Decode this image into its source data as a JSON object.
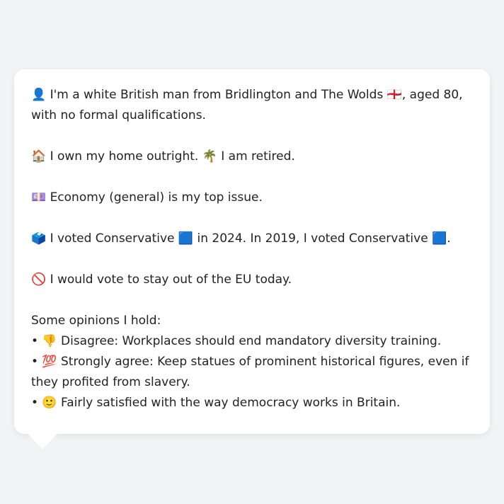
{
  "bubble": {
    "identity": "👤 I'm a white British man from Bridlington and The Wolds 🏴󠁧󠁢󠁥󠁮󠁧󠁿, aged 80, with no formal qualifications.",
    "home": "🏠 I own my home outright. 🌴 I am retired.",
    "issue": "💷 Economy (general) is my top issue.",
    "vote": "🗳️ I voted Conservative 🟦 in 2024. In 2019, I voted Conservative 🟦.",
    "eu": "🚫 I would vote to stay out of the EU today.",
    "opinions_heading": "Some opinions I hold:",
    "opinions": [
      "• 👎 Disagree: Workplaces should end mandatory diversity training.",
      "• 💯 Strongly agree: Keep statues of prominent historical figures, even if they profited from slavery.",
      "• 🙂 Fairly satisfied with the way democracy works in Britain."
    ]
  }
}
